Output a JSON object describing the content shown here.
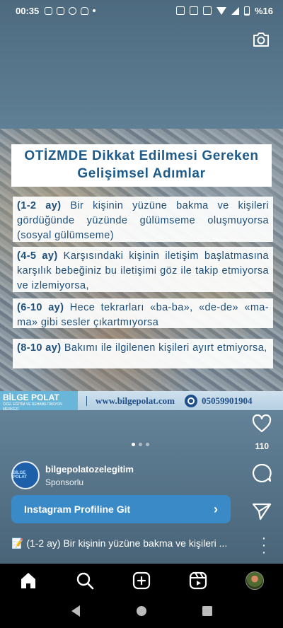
{
  "status_bar": {
    "time": "00:35",
    "battery": "%16"
  },
  "poster": {
    "title": "OTİZMDE Dikkat Edilmesi Gereken Gelişimsel Adımlar",
    "items": [
      {
        "age": "(1-2 ay)",
        "text": " Bir kişinin yüzüne bakma ve kişileri gördüğünde yüzünde gülümseme oluşmuyorsa (sosyal gülümseme)"
      },
      {
        "age": "(4-5 ay)",
        "text": " Karşısındaki kişinin iletişim başlatmasına karşılık bebeğiniz bu iletişimi göz ile takip etmiyorsa ve izlemiyorsa,"
      },
      {
        "age": "(6-10 ay)",
        "text": " Hece tekrarları «ba-ba», «de-de» «ma-ma» gibi sesler çıkartmıyorsa"
      },
      {
        "age": "(8-10 ay)",
        "text": " Bakımı ile ilgilenen kişileri ayırt etmiyorsa,"
      }
    ],
    "brand": {
      "logo": "BİLGE POLAT",
      "logo_sub": "ÖZEL EĞİTİM VE REHABİLİTASYON MERKEZİ",
      "url": "www.bilgepolat.com",
      "phone": "05059901904"
    }
  },
  "post": {
    "like_count": "110",
    "account": "bilgepolatozelegitim",
    "sponsored": "Sponsorlu",
    "cta_label": "Instagram Profiline Git",
    "caption": "📝 (1-2 ay) Bir kişinin yüzüne bakma ve kişileri ..."
  },
  "icons": [
    "camera-icon",
    "heart-icon",
    "comment-icon",
    "share-icon",
    "more-icon",
    "home-icon",
    "search-icon",
    "create-icon",
    "reels-icon",
    "profile-icon",
    "back-icon",
    "home-circle-icon",
    "recents-icon"
  ]
}
